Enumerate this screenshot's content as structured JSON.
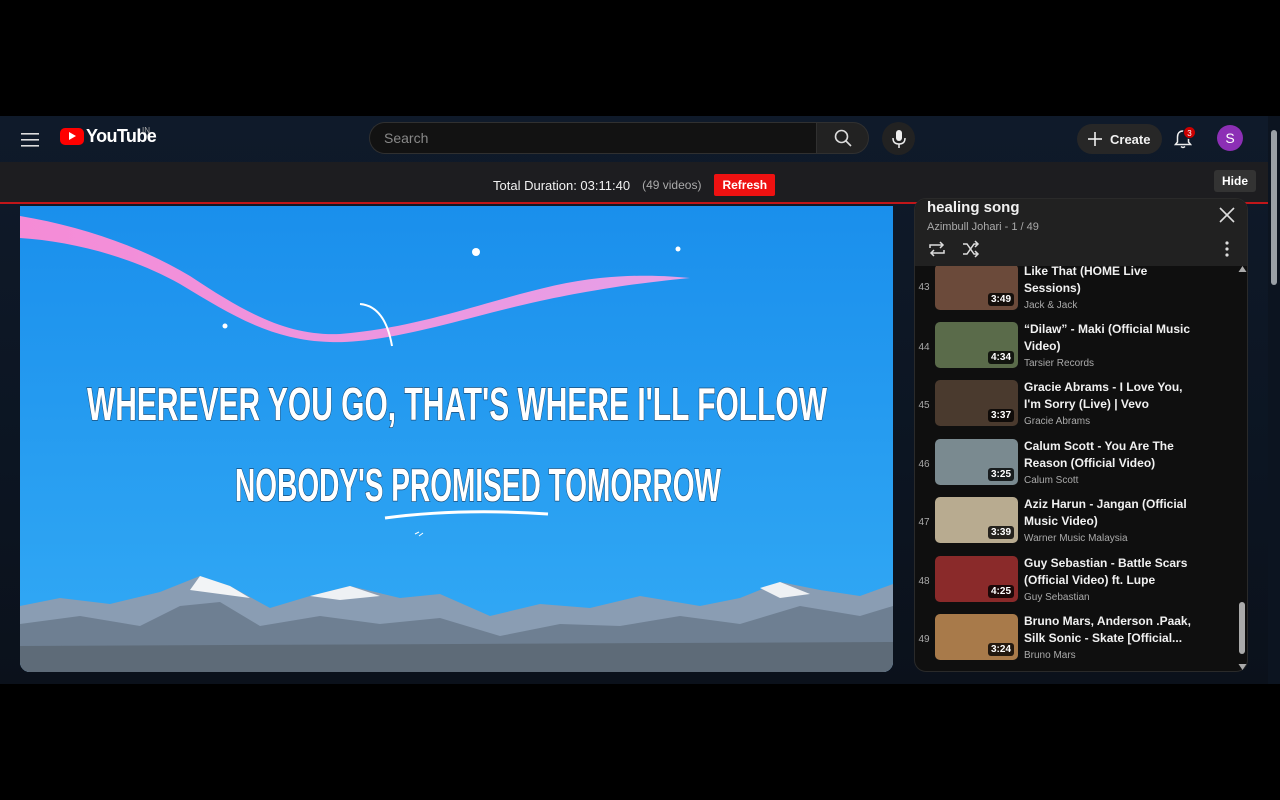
{
  "header": {
    "logo_text": "YouTube",
    "country_code": "IN",
    "search_placeholder": "Search",
    "create_label": "Create",
    "notification_count": "3",
    "avatar_letter": "S"
  },
  "duration_bar": {
    "label": "Total Duration: 03:11:40",
    "count": "(49 videos)",
    "refresh_label": "Refresh",
    "hide_label": "Hide"
  },
  "video": {
    "lyric_line_1": "WHEREVER YOU GO, THAT'S WHERE I'LL FOLLOW",
    "lyric_line_2": "NOBODY'S PROMISED TOMORROW"
  },
  "playlist": {
    "title": "healing song",
    "subtitle": "Azimbull Johari - 1 / 49",
    "items": [
      {
        "index": "43",
        "title": "Like That (HOME Live Sessions)",
        "channel": "Jack & Jack",
        "duration": "3:49",
        "color": "#6b4a3a"
      },
      {
        "index": "44",
        "title": "“Dilaw” - Maki (Official Music Video)",
        "channel": "Tarsier Records",
        "duration": "4:34",
        "color": "#5a6b4a"
      },
      {
        "index": "45",
        "title": "Gracie Abrams - I Love You, I'm Sorry (Live) | Vevo Extended...",
        "channel": "Gracie Abrams",
        "duration": "3:37",
        "color": "#4a3a2e"
      },
      {
        "index": "46",
        "title": "Calum Scott - You Are The Reason (Official Video)",
        "channel": "Calum Scott",
        "duration": "3:25",
        "color": "#7a8a90"
      },
      {
        "index": "47",
        "title": "Aziz Harun - Jangan (Official Music Video)",
        "channel": "Warner Music Malaysia",
        "duration": "3:39",
        "color": "#b8ab90"
      },
      {
        "index": "48",
        "title": "Guy Sebastian - Battle Scars (Official Video) ft. Lupe Fiasco",
        "channel": "Guy Sebastian",
        "duration": "4:25",
        "color": "#8a2a2a"
      },
      {
        "index": "49",
        "title": "Bruno Mars, Anderson .Paak, Silk Sonic - Skate [Official...",
        "channel": "Bruno Mars",
        "duration": "3:24",
        "color": "#a87a4a"
      }
    ]
  },
  "icons": {
    "menu": "menu-icon",
    "search": "search-icon",
    "mic": "mic-icon",
    "plus": "plus-icon",
    "bell": "bell-icon",
    "close": "close-icon",
    "loop": "loop-icon",
    "shuffle": "shuffle-icon",
    "more": "more-vert-icon"
  },
  "colors": {
    "brand_red": "#ff0000",
    "refresh_red": "#ee1111",
    "avatar": "#8c2fb5",
    "sky": "#1e90ef"
  }
}
